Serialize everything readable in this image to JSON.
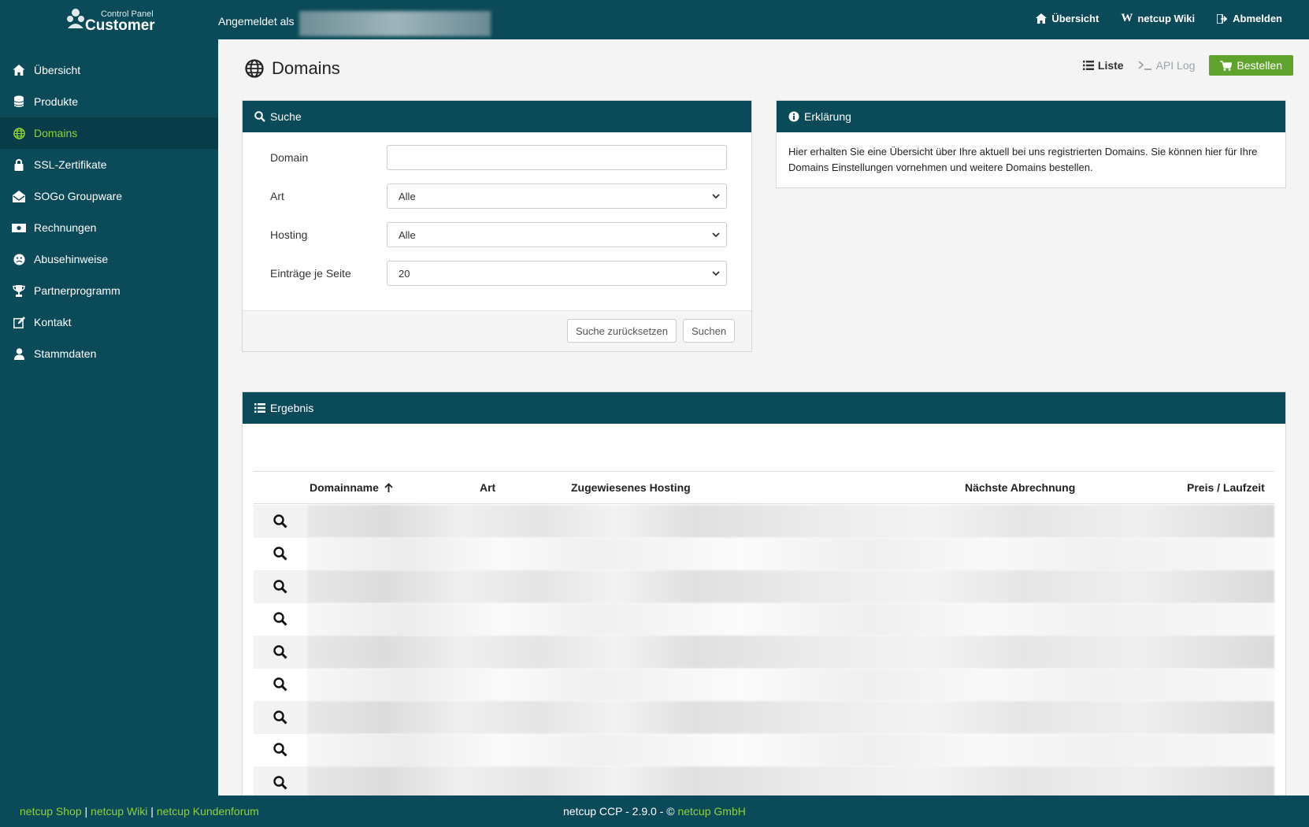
{
  "header": {
    "logo_small": "Control Panel",
    "logo_big": "Customer",
    "logged_in_label": "Angemeldet als",
    "nav": [
      {
        "label": "Übersicht",
        "icon": "home-icon"
      },
      {
        "label": "netcup Wiki",
        "icon": "wikipedia-icon"
      },
      {
        "label": "Abmelden",
        "icon": "logout-icon"
      }
    ]
  },
  "sidebar": {
    "items": [
      {
        "label": "Übersicht",
        "icon": "home-icon"
      },
      {
        "label": "Produkte",
        "icon": "database-icon"
      },
      {
        "label": "Domains",
        "icon": "globe-icon",
        "active": true
      },
      {
        "label": "SSL-Zertifikate",
        "icon": "lock-icon"
      },
      {
        "label": "SOGo Groupware",
        "icon": "envelope-open-icon"
      },
      {
        "label": "Rechnungen",
        "icon": "money-bill-icon"
      },
      {
        "label": "Abusehinweise",
        "icon": "frown-icon"
      },
      {
        "label": "Partnerprogramm",
        "icon": "trophy-icon"
      },
      {
        "label": "Kontakt",
        "icon": "edit-icon"
      },
      {
        "label": "Stammdaten",
        "icon": "user-icon"
      }
    ]
  },
  "page": {
    "title": "Domains",
    "actions": {
      "list": "Liste",
      "api_log": "API Log",
      "order": "Bestellen"
    }
  },
  "search": {
    "title": "Suche",
    "domain_label": "Domain",
    "domain_value": "",
    "type_label": "Art",
    "type_value": "Alle",
    "hosting_label": "Hosting",
    "hosting_value": "Alle",
    "per_page_label": "Einträge je Seite",
    "per_page_value": "20",
    "reset_button": "Suche zurücksetzen",
    "search_button": "Suchen"
  },
  "info": {
    "title": "Erklärung",
    "text": "Hier erhalten Sie eine Übersicht über Ihre aktuell bei uns registrierten Domains. Sie können hier für Ihre Domains Einstellungen vornehmen und weitere Domains bestellen."
  },
  "result": {
    "title": "Ergebnis",
    "columns": {
      "domain": "Domainname",
      "type": "Art",
      "hosting": "Zugewiesenes Hosting",
      "next_billing": "Nächste Abrechnung",
      "price": "Preis / Laufzeit"
    },
    "sort": {
      "column": "domain",
      "direction": "ascending"
    }
  },
  "footer": {
    "shop": "netcup Shop",
    "wiki": "netcup Wiki",
    "forum": "netcup Kundenforum",
    "separator": "|",
    "version": "netcup CCP - 2.9.0 - ©",
    "company": "netcup GmbH"
  },
  "colors": {
    "primary": "#0b4a59",
    "accent_green": "#8fd23c",
    "button_green": "#5fa32d"
  }
}
